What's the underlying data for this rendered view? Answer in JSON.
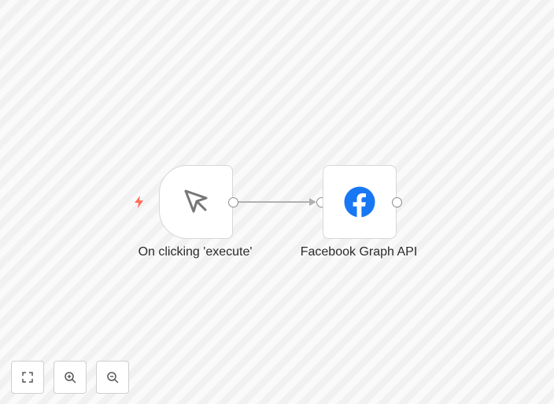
{
  "nodes": {
    "trigger": {
      "label": "On clicking 'execute'",
      "icon": "mouse-pointer-icon",
      "badge_icon": "lightning-bolt-icon",
      "badge_color": "#ff6d5a"
    },
    "action": {
      "label": "Facebook Graph API",
      "icon": "facebook-icon",
      "brand_color": "#1877f2"
    }
  },
  "controls": {
    "fit_view_icon": "fit-view-icon",
    "zoom_in_icon": "zoom-in-icon",
    "zoom_out_icon": "zoom-out-icon"
  },
  "colors": {
    "connection": "#b1b1b1",
    "handle_border": "#8d8d8d",
    "icon": "#777777"
  }
}
